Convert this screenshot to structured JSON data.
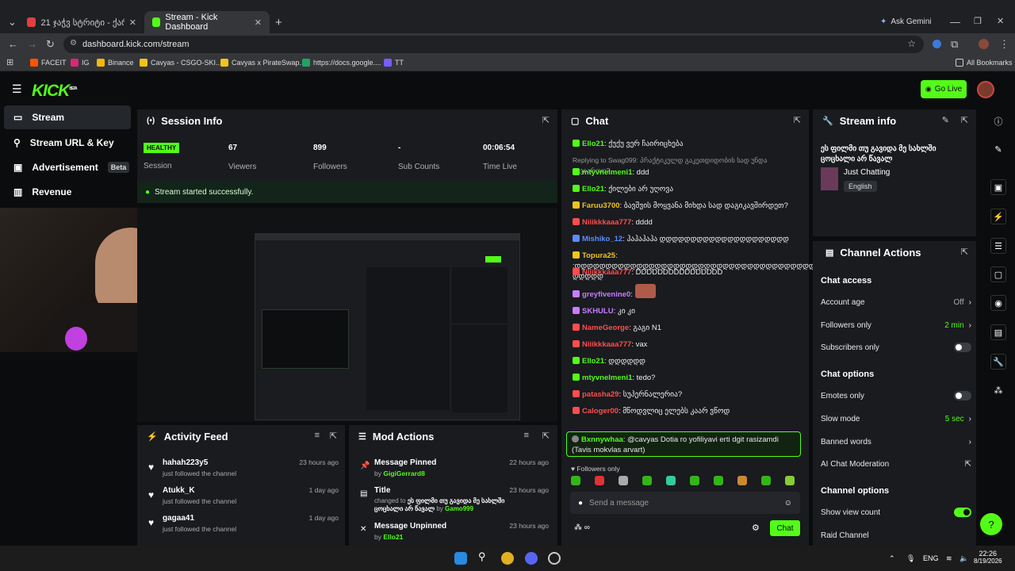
{
  "browser": {
    "tabs": [
      {
        "title": "21 ჯაჭვ სტრიტი - ქართულ..."
      },
      {
        "title": "Stream - Kick Dashboard"
      }
    ],
    "url": "dashboard.kick.com/stream",
    "ask_gemini": "Ask Gemini",
    "bookmarks": [
      "FACEIT",
      "IG",
      "Binance",
      "Cavyas - CSGO-SKI...",
      "Cavyas x PirateSwap...",
      "https://docs.google....",
      "TT"
    ],
    "all_bookmarks": "All Bookmarks"
  },
  "header": {
    "logo": "KICK",
    "logo_sup": "BETA",
    "go_live": "Go Live"
  },
  "sidebar": {
    "items": [
      {
        "label": "Stream"
      },
      {
        "label": "Stream URL & Key"
      },
      {
        "label": "Advertisement",
        "badge": "Beta"
      },
      {
        "label": "Revenue"
      }
    ]
  },
  "session": {
    "title": "Session Info",
    "health": "HEALTHY",
    "health_label": "Session",
    "stats": [
      {
        "value": "67",
        "label": "Viewers"
      },
      {
        "value": "899",
        "label": "Followers"
      },
      {
        "value": "-",
        "label": "Sub Counts"
      },
      {
        "value": "00:06:54",
        "label": "Time Live"
      }
    ],
    "success": "Stream started successfully."
  },
  "chat": {
    "title": "Chat",
    "messages": [
      {
        "user": "Ello21",
        "text": "ქუქუ ვერ ჩაირიცხება",
        "color": "#53fc18"
      },
      {
        "reply": "Replying to Swag099: პრაქტიკულდ გაკეთდიდობის სად უნდა გავიაროო?"
      },
      {
        "user": "mtyvnelmeni1",
        "text": "ddd",
        "color": "#53fc18"
      },
      {
        "user": "Ello21",
        "text": "ქილები არ უღოვა",
        "color": "#53fc18"
      },
      {
        "user": "Faruu3700",
        "text": "ბავშვის მოყვანა მიხდა სად დაგიკავშირდეთ?",
        "color": "#f0c419"
      },
      {
        "user": "Niiikkkaaa777",
        "text": "dddd",
        "color": "#ff4d4d"
      },
      {
        "user": "Mishiko_12",
        "text": "ჰაჰაჰაჰა დდდდდდდდდდდდდდდდდდდდდ",
        "color": "#5b8cff"
      },
      {
        "user": "Topura25",
        "text": ":დდდდდდდდდდდდდდდდდდდდდდდდდდდდდდდდდდდდდდდდდდდდდდ დდდდდ",
        "color": "#f0c419"
      },
      {
        "user": "Niiikkkaaa777",
        "text": "DDDDDDDDDDDDDDDD",
        "color": "#ff4d4d"
      },
      {
        "user": "greyfivenine0",
        "text": "",
        "color": "#c77dff"
      },
      {
        "user": "SKHULU",
        "text": "კი კი",
        "color": "#c77dff"
      },
      {
        "user": "NameGeorge",
        "text": "გაგი N1",
        "color": "#ff4d4d"
      },
      {
        "user": "Niiikkkaaa777",
        "text": "vax",
        "color": "#ff4d4d"
      },
      {
        "user": "Ello21",
        "text": "დდდდდდ",
        "color": "#53fc18"
      },
      {
        "user": "mtyvnelmeni1",
        "text": "tedo?",
        "color": "#53fc18"
      },
      {
        "user": "patasha29",
        "text": "სუპერნალერია?",
        "color": "#ff4d4d"
      },
      {
        "user": "Caloger00",
        "text": "მწოდვლიც ელებს კაარ ვწოდ",
        "color": "#ff4d4d"
      }
    ],
    "highlight": {
      "user": "Bxnnywhaa",
      "text": "@cavyas Dotia ro yofiliyavi erti dgit rasizamdi (Tavis mokvlas arvart)"
    },
    "followers_only": "Followers only",
    "placeholder": "Send a message",
    "send": "Chat"
  },
  "activity": {
    "title": "Activity Feed",
    "items": [
      {
        "name": "hahah223y5",
        "sub": "just followed the channel",
        "time": "23 hours ago"
      },
      {
        "name": "Atukk_K",
        "sub": "just followed the channel",
        "time": "1 day ago"
      },
      {
        "name": "gagaa41",
        "sub": "just followed the channel",
        "time": "1 day ago"
      }
    ]
  },
  "mod": {
    "title": "Mod Actions",
    "items": [
      {
        "title": "Message Pinned",
        "by": "by",
        "user": "GigiGerrard8",
        "time": "22 hours ago"
      },
      {
        "title": "Title",
        "pre": "changed to",
        "text": "ეს ფილმი თუ გავიდა მე სახლში ცოცხალი არ წავალ",
        "by": "by",
        "user": "Gamo999",
        "time": "23 hours ago"
      },
      {
        "title": "Message Unpinned",
        "by": "by",
        "user": "Ello21",
        "time": "23 hours ago"
      }
    ]
  },
  "stream_info": {
    "title": "Stream info",
    "stream_title": "ეს ფილმი თუ გავიდა მე სახლში ცოცხალი არ წავალ",
    "category": "Just Chatting",
    "language": "English"
  },
  "channel_actions": {
    "title": "Channel Actions",
    "chat_access": "Chat access",
    "account_age": "Account age",
    "account_age_val": "Off",
    "followers_only": "Followers only",
    "followers_only_val": "2 min",
    "subscribers_only": "Subscribers only",
    "chat_options": "Chat options",
    "emotes_only": "Emotes only",
    "slow_mode": "Slow mode",
    "slow_mode_val": "5 sec",
    "banned_words": "Banned words",
    "ai_moderation": "AI Chat Moderation",
    "channel_options": "Channel options",
    "show_view_count": "Show view count",
    "raid_channel": "Raid Channel"
  },
  "taskbar": {
    "lang": "ENG",
    "time": "22:26",
    "date": "8/19/2026"
  },
  "colors": {
    "accent": "#53fc18",
    "panel": "#191b1f",
    "bg": "#0b0c0d"
  }
}
